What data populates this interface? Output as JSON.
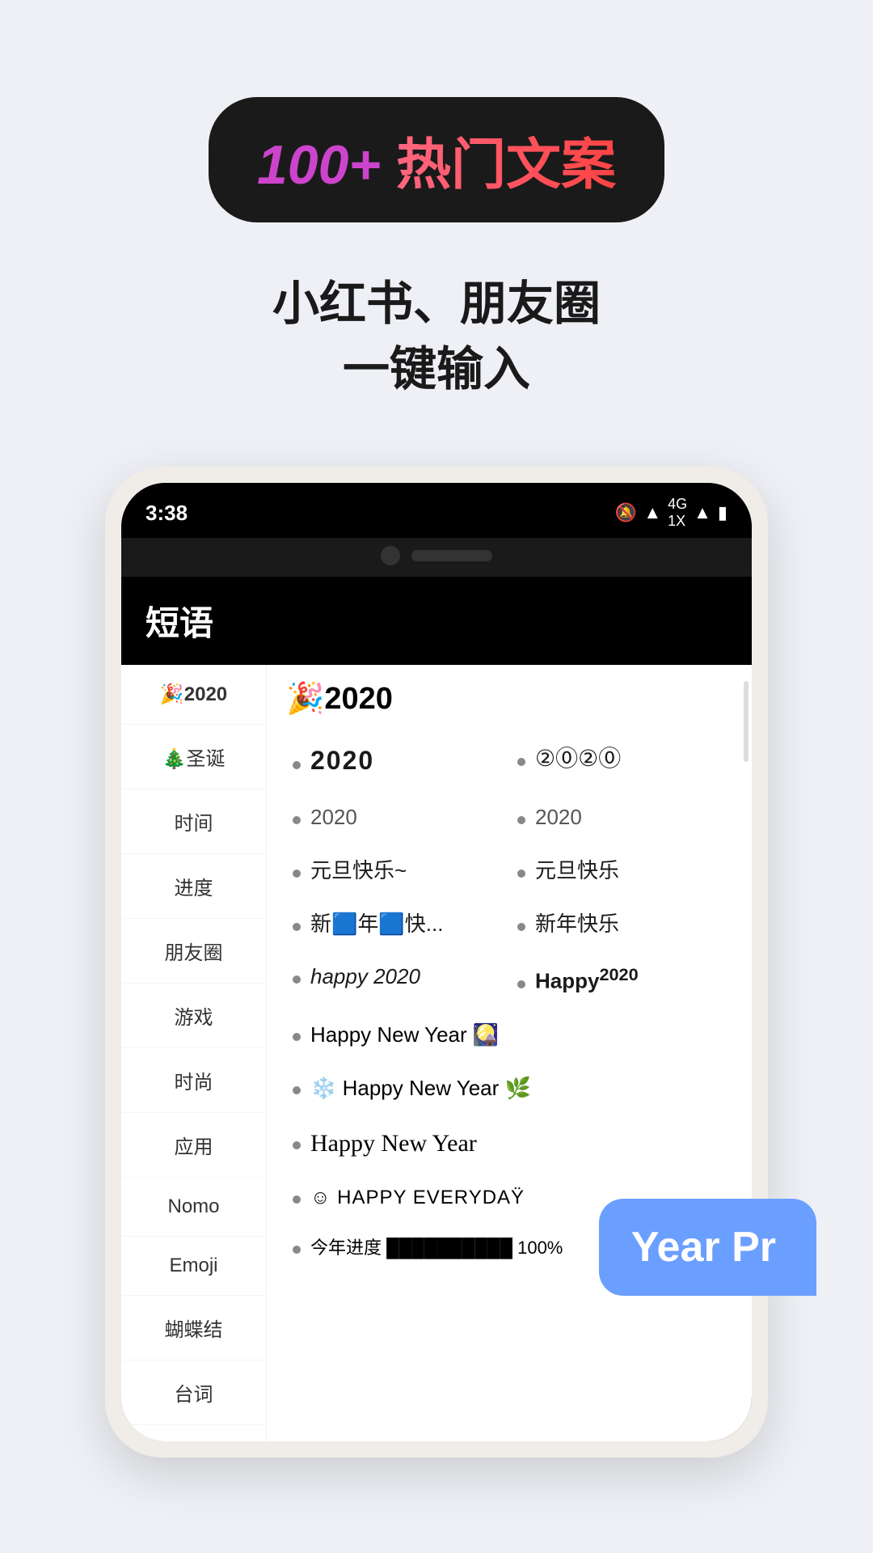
{
  "header": {
    "badge": {
      "number": "100+",
      "label": "热门文案"
    },
    "subtitle_line1": "小红书、朋友圈",
    "subtitle_line2": "一键输入"
  },
  "phone": {
    "status_bar": {
      "time": "3:38",
      "icons": "🔕 📶 4G 1X 📶 🔋"
    },
    "app_title": "短语",
    "sidebar_items": [
      {
        "id": "2020",
        "label": "🎉2020",
        "active": true
      },
      {
        "id": "christmas",
        "label": "🎄圣诞"
      },
      {
        "id": "time",
        "label": "时间"
      },
      {
        "id": "progress",
        "label": "进度"
      },
      {
        "id": "social",
        "label": "朋友圈"
      },
      {
        "id": "game",
        "label": "游戏"
      },
      {
        "id": "fashion",
        "label": "时尚"
      },
      {
        "id": "app",
        "label": "应用"
      },
      {
        "id": "nomo",
        "label": "Nomo"
      },
      {
        "id": "emoji",
        "label": "Emoji"
      },
      {
        "id": "bowtie",
        "label": "蝴蝶结"
      },
      {
        "id": "lines",
        "label": "台词"
      }
    ],
    "section_title": "🎉2020",
    "items": [
      {
        "col": 1,
        "text": "2020",
        "style": "styled-2020"
      },
      {
        "col": 2,
        "text": "②⓪②⓪",
        "style": "circled-2020"
      },
      {
        "col": 1,
        "text": "2020",
        "style": "plain-2020"
      },
      {
        "col": 2,
        "text": "2020",
        "style": "plain-2020"
      },
      {
        "col": 1,
        "text": "元旦快乐~",
        "style": ""
      },
      {
        "col": 2,
        "text": "元旦快乐",
        "style": ""
      },
      {
        "col": 1,
        "text": "新🟦年🟦快...",
        "style": ""
      },
      {
        "col": 2,
        "text": "新年快乐",
        "style": ""
      },
      {
        "col": 1,
        "text": "happy 2020",
        "style": "italic-style"
      },
      {
        "col": 2,
        "text": "Happy2020",
        "style": "bold"
      },
      {
        "full": true,
        "text": "Happy New Year 🎑",
        "style": ""
      },
      {
        "full": true,
        "text": "❄️ Happy New Year 🌿",
        "style": ""
      },
      {
        "full": true,
        "text": "Happy New Year",
        "style": "script-style"
      },
      {
        "full": true,
        "text": "☺ HAPPY EVERYDAŸ",
        "style": "small-caps-style"
      },
      {
        "full": true,
        "text": "今年进度 ██████████ 100%",
        "style": ""
      }
    ]
  },
  "speech_bubble": {
    "text": "Year Pr"
  }
}
